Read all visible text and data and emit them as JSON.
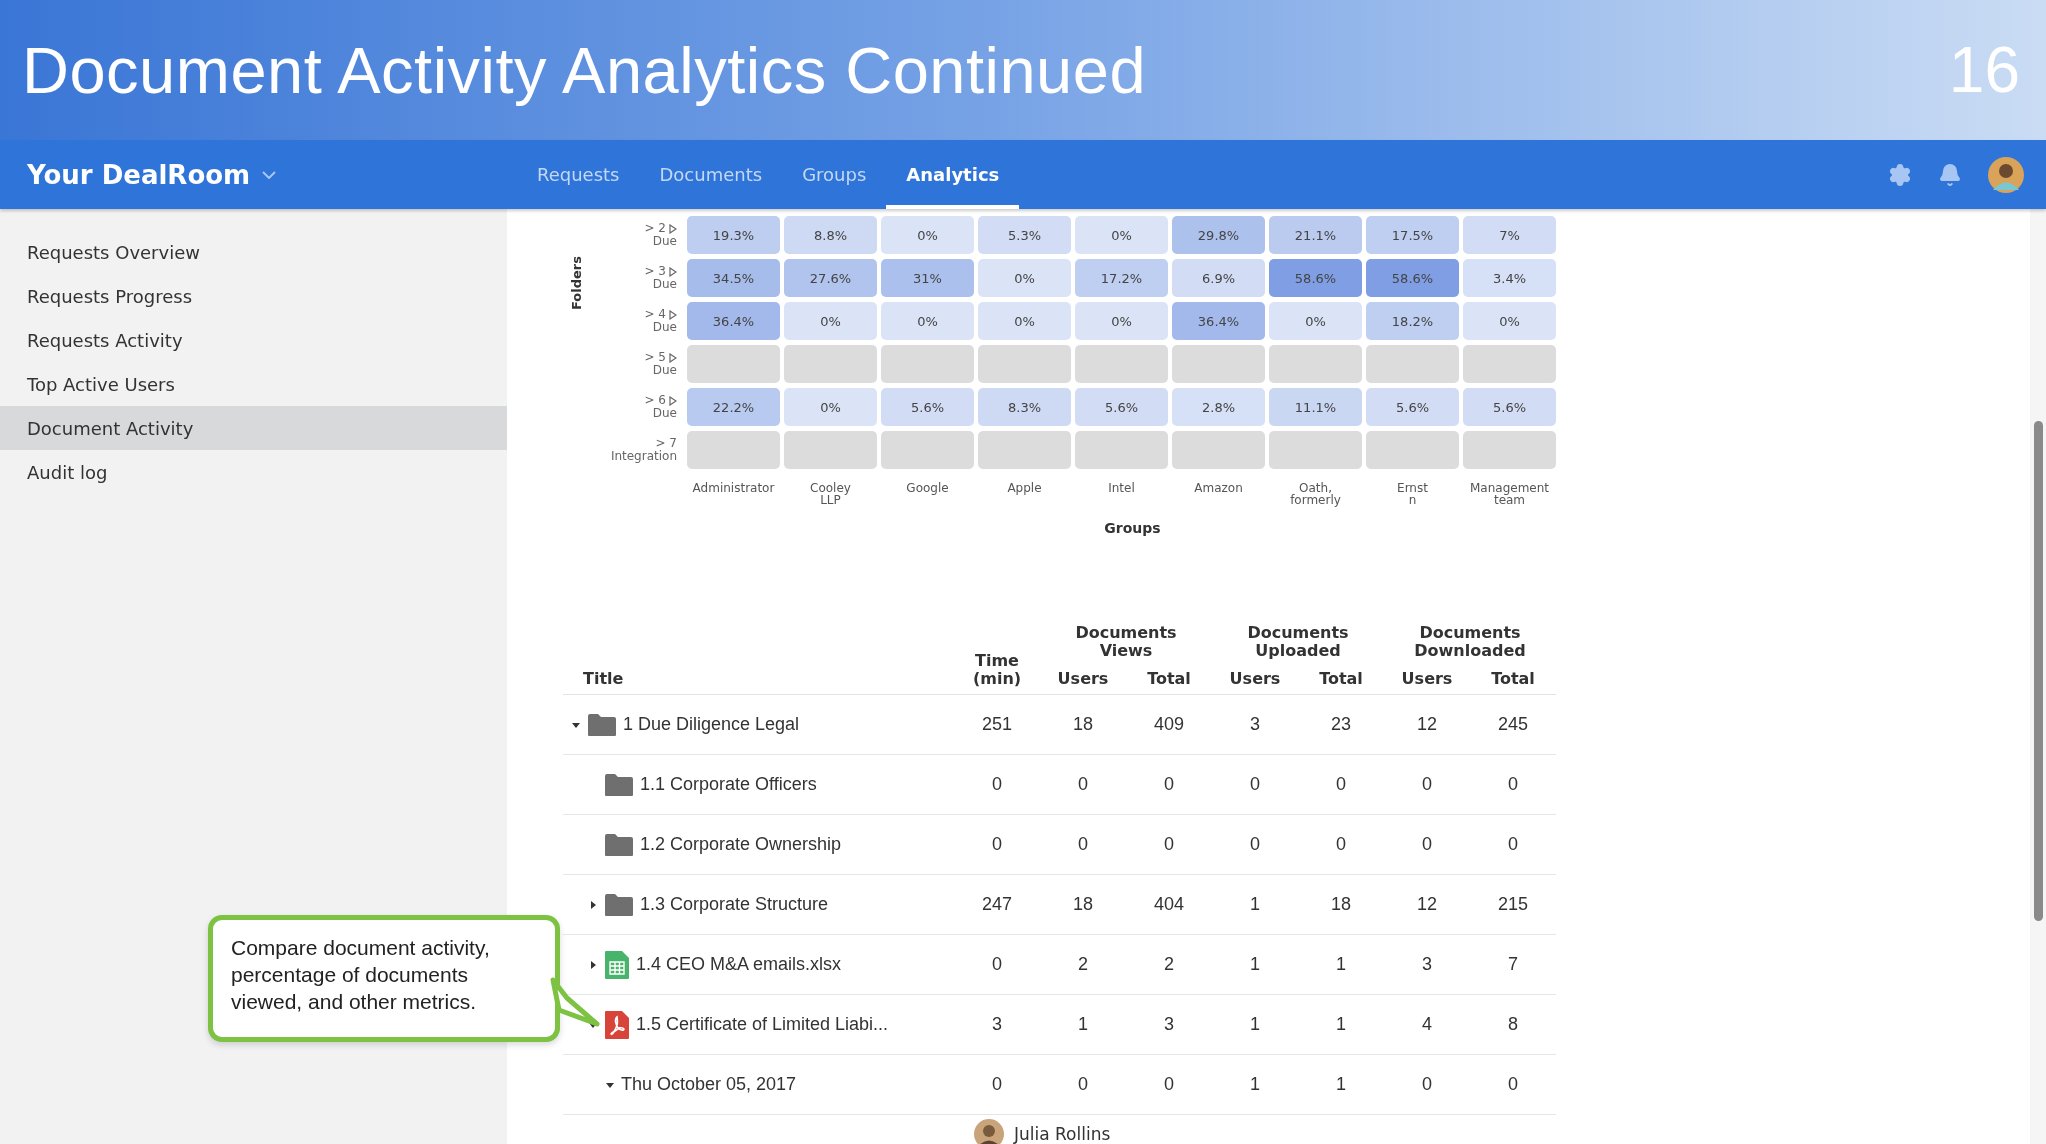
{
  "slide": {
    "title": "Document Activity Analytics Continued",
    "page_number": "16"
  },
  "navbar": {
    "brand": "Your DealRoom",
    "tabs": [
      {
        "label": "Requests",
        "selected": false
      },
      {
        "label": "Documents",
        "selected": false
      },
      {
        "label": "Groups",
        "selected": false
      },
      {
        "label": "Analytics",
        "selected": true
      }
    ]
  },
  "sidebar": {
    "items": [
      {
        "label": "Requests Overview",
        "selected": false
      },
      {
        "label": "Requests Progress",
        "selected": false
      },
      {
        "label": "Requests Activity",
        "selected": false
      },
      {
        "label": "Top Active Users",
        "selected": false
      },
      {
        "label": "Document Activity",
        "selected": true
      },
      {
        "label": "Audit log",
        "selected": false
      }
    ]
  },
  "heatmap": {
    "y_label": "Folders",
    "rows": [
      {
        "lines": [
          "> 2",
          "Due"
        ],
        "toggle": true,
        "cells": [
          {
            "value": "19.3%",
            "color": "#beceF1"
          },
          {
            "value": "8.8%",
            "color": "#cedaf4"
          },
          {
            "value": "0%",
            "color": "#dbe4f7"
          },
          {
            "value": "5.3%",
            "color": "#d2ddf5"
          },
          {
            "value": "0%",
            "color": "#dbe4f7"
          },
          {
            "value": "29.8%",
            "color": "#adc1ed"
          },
          {
            "value": "21.1%",
            "color": "#bbcbf0"
          },
          {
            "value": "17.5%",
            "color": "#bfcff1"
          },
          {
            "value": "7%",
            "color": "#d2ddf5"
          }
        ]
      },
      {
        "lines": [
          "> 3",
          "Due"
        ],
        "toggle": true,
        "cells": [
          {
            "value": "34.5%",
            "color": "#a6bceb"
          },
          {
            "value": "27.6%",
            "color": "#b1c4ee"
          },
          {
            "value": "31%",
            "color": "#abc0ed"
          },
          {
            "value": "0%",
            "color": "#dbe4f7"
          },
          {
            "value": "17.2%",
            "color": "#bfcff1"
          },
          {
            "value": "6.9%",
            "color": "#d2ddf5"
          },
          {
            "value": "58.6%",
            "color": "#7f9ee3"
          },
          {
            "value": "58.6%",
            "color": "#7f9ee3"
          },
          {
            "value": "3.4%",
            "color": "#d6e0f6"
          }
        ]
      },
      {
        "lines": [
          "> 4",
          "Due"
        ],
        "toggle": true,
        "cells": [
          {
            "value": "36.4%",
            "color": "#a3b9eb"
          },
          {
            "value": "0%",
            "color": "#dbe4f7"
          },
          {
            "value": "0%",
            "color": "#dbe4f7"
          },
          {
            "value": "0%",
            "color": "#dbe4f7"
          },
          {
            "value": "0%",
            "color": "#dbe4f7"
          },
          {
            "value": "36.4%",
            "color": "#a3b9eb"
          },
          {
            "value": "0%",
            "color": "#dbe4f7"
          },
          {
            "value": "18.2%",
            "color": "#bfcff1"
          },
          {
            "value": "0%",
            "color": "#dbe4f7"
          }
        ]
      },
      {
        "lines": [
          "> 5",
          "Due"
        ],
        "toggle": true,
        "cells": [
          {
            "color": "#dcdcdc"
          },
          {
            "color": "#dcdcdc"
          },
          {
            "color": "#dcdcdc"
          },
          {
            "color": "#dcdcdc"
          },
          {
            "color": "#dcdcdc"
          },
          {
            "color": "#dcdcdc"
          },
          {
            "color": "#dcdcdc"
          },
          {
            "color": "#dcdcdc"
          },
          {
            "color": "#dcdcdc"
          }
        ]
      },
      {
        "lines": [
          "> 6",
          "Due"
        ],
        "toggle": true,
        "cells": [
          {
            "value": "22.2%",
            "color": "#b9caf0"
          },
          {
            "value": "0%",
            "color": "#dbe4f7"
          },
          {
            "value": "5.6%",
            "color": "#d2ddf5"
          },
          {
            "value": "8.3%",
            "color": "#cedaf4"
          },
          {
            "value": "5.6%",
            "color": "#d2ddf5"
          },
          {
            "value": "2.8%",
            "color": "#d6e0f6"
          },
          {
            "value": "11.1%",
            "color": "#cad7f3"
          },
          {
            "value": "5.6%",
            "color": "#d2ddf5"
          },
          {
            "value": "5.6%",
            "color": "#d2ddf5"
          }
        ]
      },
      {
        "lines": [
          "> 7",
          "Integration"
        ],
        "toggle": false,
        "cells": [
          {
            "color": "#dcdcdc"
          },
          {
            "color": "#dcdcdc"
          },
          {
            "color": "#dcdcdc"
          },
          {
            "color": "#dcdcdc"
          },
          {
            "color": "#dcdcdc"
          },
          {
            "color": "#dcdcdc"
          },
          {
            "color": "#dcdcdc"
          },
          {
            "color": "#dcdcdc"
          },
          {
            "color": "#dcdcdc"
          }
        ]
      }
    ],
    "x_categories": [
      {
        "lines": [
          "Administrator"
        ]
      },
      {
        "lines": [
          "Cooley",
          "LLP"
        ]
      },
      {
        "lines": [
          "Google"
        ]
      },
      {
        "lines": [
          "Apple"
        ]
      },
      {
        "lines": [
          "Intel"
        ]
      },
      {
        "lines": [
          "Amazon"
        ]
      },
      {
        "lines": [
          "Oath,",
          "formerly"
        ]
      },
      {
        "lines": [
          "Ernst",
          "n"
        ]
      },
      {
        "lines": [
          "Management",
          "team"
        ]
      }
    ],
    "x_label": "Groups"
  },
  "table": {
    "column_groups": [
      {
        "lines": [
          "Documents",
          "Views"
        ]
      },
      {
        "lines": [
          "Documents",
          "Uploaded"
        ]
      },
      {
        "lines": [
          "Documents",
          "Downloaded"
        ]
      }
    ],
    "columns": [
      {
        "lines": [
          "Title"
        ]
      },
      {
        "lines": [
          "Time",
          "(min)"
        ]
      },
      {
        "lines": [
          "Users"
        ]
      },
      {
        "lines": [
          "Total"
        ]
      },
      {
        "lines": [
          "Users"
        ]
      },
      {
        "lines": [
          "Total"
        ]
      },
      {
        "lines": [
          "Users"
        ]
      },
      {
        "lines": [
          "Total"
        ]
      }
    ],
    "rows": [
      {
        "kind": "folder",
        "title": "1 Due Diligence Legal",
        "expanded": true,
        "values": [
          "251",
          "18",
          "409",
          "3",
          "23",
          "12",
          "245"
        ],
        "children": [
          {
            "kind": "folder",
            "title": "1.1 Corporate Officers",
            "values": [
              "0",
              "0",
              "0",
              "0",
              "0",
              "0",
              "0"
            ]
          },
          {
            "kind": "folder",
            "title": "1.2 Corporate Ownership",
            "values": [
              "0",
              "0",
              "0",
              "0",
              "0",
              "0",
              "0"
            ]
          },
          {
            "kind": "folder",
            "title": "1.3 Corporate Structure",
            "expanded": false,
            "values": [
              "247",
              "18",
              "404",
              "1",
              "18",
              "12",
              "215"
            ]
          },
          {
            "kind": "spreadsheet",
            "title": "1.4 CEO M&A emails.xlsx",
            "expanded": false,
            "values": [
              "0",
              "2",
              "2",
              "1",
              "1",
              "3",
              "7"
            ]
          },
          {
            "kind": "pdf",
            "title": "1.5 Certificate of Limited Liabi...",
            "expanded": true,
            "values": [
              "3",
              "1",
              "3",
              "1",
              "1",
              "4",
              "8"
            ],
            "children": [
              {
                "kind": "date",
                "title": "Thu October 05, 2017",
                "expanded": true,
                "values": [
                  "0",
                  "0",
                  "0",
                  "1",
                  "1",
                  "0",
                  "0"
                ],
                "children": [
                  {
                    "kind": "event",
                    "user": "Julia Rollins"
                  }
                ]
              }
            ]
          }
        ]
      }
    ]
  },
  "callout": {
    "text": "Compare document activity, percentage of documents viewed, and other metrics."
  }
}
